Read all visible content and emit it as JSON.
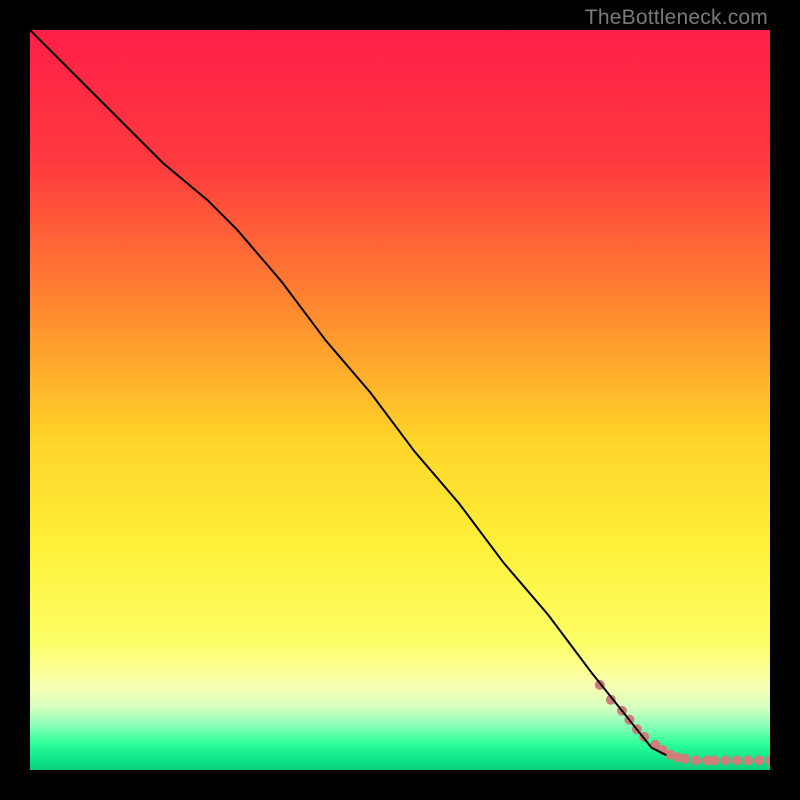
{
  "watermark": "TheBottleneck.com",
  "chart_data": {
    "type": "line",
    "title": "",
    "xlabel": "",
    "ylabel": "",
    "xlim": [
      0,
      100
    ],
    "ylim": [
      0,
      100
    ],
    "grid": false,
    "background_gradient": {
      "stops": [
        {
          "offset": 0.0,
          "color": "#ff1f47"
        },
        {
          "offset": 0.18,
          "color": "#ff3a3f"
        },
        {
          "offset": 0.38,
          "color": "#ff8a2f"
        },
        {
          "offset": 0.55,
          "color": "#ffd328"
        },
        {
          "offset": 0.7,
          "color": "#fff13a"
        },
        {
          "offset": 0.83,
          "color": "#fdff68"
        },
        {
          "offset": 0.885,
          "color": "#f9ffb0"
        },
        {
          "offset": 0.915,
          "color": "#d7ffc0"
        },
        {
          "offset": 0.94,
          "color": "#88ffb8"
        },
        {
          "offset": 0.965,
          "color": "#2dff99"
        },
        {
          "offset": 0.985,
          "color": "#0ee689"
        },
        {
          "offset": 1.0,
          "color": "#0bcf7c"
        }
      ]
    },
    "series": [
      {
        "name": "curve",
        "type": "line",
        "color": "#000000",
        "width": 2,
        "x": [
          0,
          10,
          18,
          24,
          28,
          34,
          40,
          46,
          52,
          58,
          64,
          70,
          76,
          80,
          84,
          86
        ],
        "y": [
          100,
          90,
          82,
          77,
          73,
          66,
          58,
          51,
          43,
          36,
          28,
          21,
          13,
          8,
          3,
          2
        ]
      },
      {
        "name": "tail-points",
        "type": "scatter",
        "color": "#cf7f7a",
        "radius": 5,
        "x": [
          77,
          78.5,
          80,
          81,
          82,
          83,
          84.5,
          85.5,
          86.5,
          87.5,
          88.5,
          90,
          91.5,
          92.5,
          94,
          95.5,
          97,
          98.5,
          100
        ],
        "y": [
          11.5,
          9.5,
          8,
          6.8,
          5.5,
          4.5,
          3.4,
          2.7,
          2.1,
          1.7,
          1.5,
          1.3,
          1.3,
          1.3,
          1.3,
          1.3,
          1.3,
          1.3,
          1.3
        ]
      }
    ]
  }
}
